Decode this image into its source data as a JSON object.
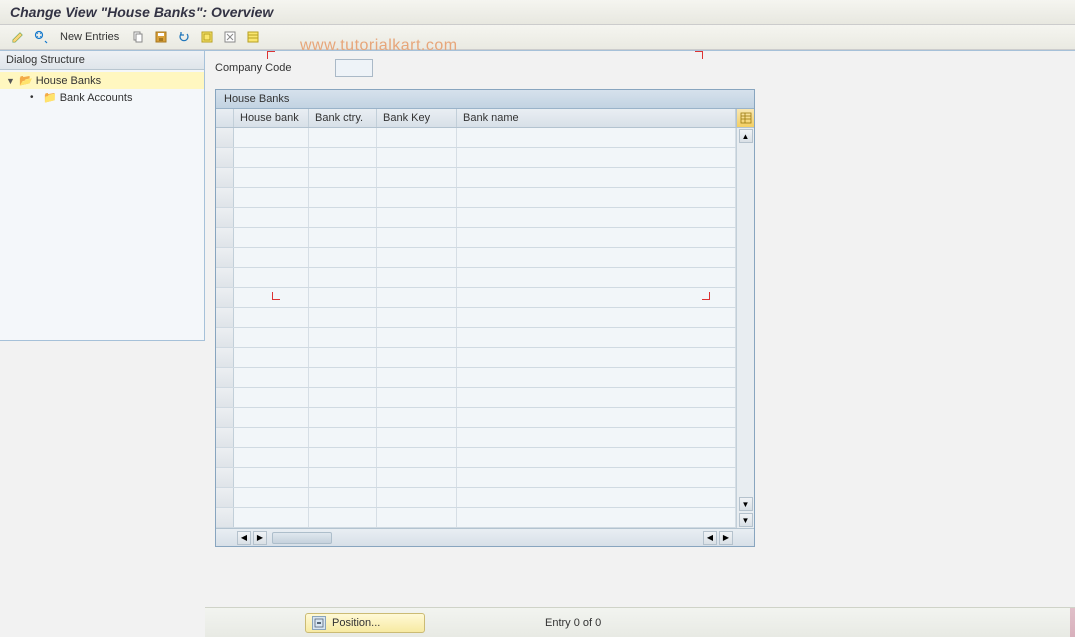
{
  "title": "Change View \"House Banks\": Overview",
  "toolbar": {
    "new_entries_label": "New Entries"
  },
  "sidebar": {
    "title": "Dialog Structure",
    "items": [
      {
        "label": "House Banks",
        "open": true,
        "selected": true
      },
      {
        "label": "Bank Accounts",
        "open": false,
        "selected": false
      }
    ]
  },
  "form": {
    "company_code_label": "Company Code",
    "company_code_value": ""
  },
  "grid": {
    "title": "House Banks",
    "columns": [
      "House bank",
      "Bank ctry.",
      "Bank Key",
      "Bank name"
    ],
    "row_count": 20
  },
  "footer": {
    "position_label": "Position...",
    "entry_text": "Entry 0 of 0"
  },
  "watermark": "www.tutorialkart.com"
}
